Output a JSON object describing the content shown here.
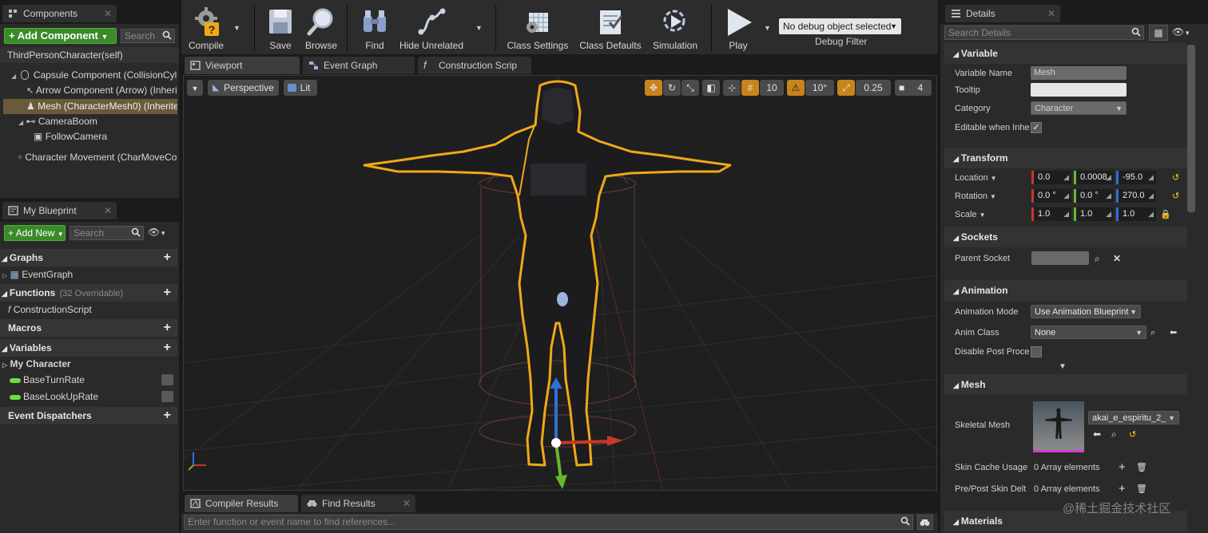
{
  "components": {
    "tab_label": "Components",
    "add_component_label": "+ Add Component",
    "search_placeholder": "Search",
    "self_label": "ThirdPersonCharacter(self)",
    "tree": [
      {
        "label": "Capsule Component (CollisionCylin"
      },
      {
        "label": "Arrow Component (Arrow) (Inheri"
      },
      {
        "label": "Mesh (CharacterMesh0) (Inherite"
      },
      {
        "label": "CameraBoom"
      },
      {
        "label": "FollowCamera"
      },
      {
        "label": "Character Movement (CharMoveCo"
      }
    ]
  },
  "my_blueprint": {
    "tab_label": "My Blueprint",
    "add_new_label": "+ Add New",
    "search_placeholder": "Search",
    "sections": {
      "graphs": "Graphs",
      "event_graph": "EventGraph",
      "functions": "Functions",
      "functions_count": "(32 Overridable)",
      "construction_script": "ConstructionScript",
      "macros": "Macros",
      "variables": "Variables",
      "my_character": "My Character",
      "var1": "BaseTurnRate",
      "var2": "BaseLookUpRate",
      "event_dispatchers": "Event Dispatchers"
    }
  },
  "toolbar": {
    "compile": "Compile",
    "save": "Save",
    "browse": "Browse",
    "find": "Find",
    "hide_unrelated": "Hide Unrelated",
    "class_settings": "Class Settings",
    "class_defaults": "Class Defaults",
    "simulation": "Simulation",
    "play": "Play",
    "debug_object": "No debug object selected",
    "debug_filter": "Debug Filter"
  },
  "editor_tabs": {
    "viewport": "Viewport",
    "event_graph": "Event Graph",
    "construction_script": "Construction Scrip"
  },
  "viewport": {
    "perspective": "Perspective",
    "lit": "Lit",
    "grid_snap": "10",
    "rot_snap": "10°",
    "scale_snap": "0.25",
    "cam_speed": "4"
  },
  "bottom": {
    "compiler_results": "Compiler Results",
    "find_results": "Find Results",
    "find_placeholder": "Enter function or event name to find references..."
  },
  "details": {
    "tab_label": "Details",
    "search_placeholder": "Search Details",
    "variable": {
      "header": "Variable",
      "name_label": "Variable Name",
      "name_value": "Mesh",
      "tooltip_label": "Tooltip",
      "category_label": "Category",
      "category_value": "Character",
      "editable_label": "Editable when Inhe"
    },
    "transform": {
      "header": "Transform",
      "location_label": "Location",
      "loc": [
        "0.0",
        "0.0008",
        "-95.0"
      ],
      "rotation_label": "Rotation",
      "rot": [
        "0.0 °",
        "0.0 °",
        "270.0"
      ],
      "scale_label": "Scale",
      "scale": [
        "1.0",
        "1.0",
        "1.0"
      ]
    },
    "sockets": {
      "header": "Sockets",
      "parent_socket_label": "Parent Socket"
    },
    "animation": {
      "header": "Animation",
      "mode_label": "Animation Mode",
      "mode_value": "Use Animation Blueprint",
      "anim_class_label": "Anim Class",
      "anim_class_value": "None",
      "disable_post_label": "Disable Post Proce"
    },
    "mesh": {
      "header": "Mesh",
      "skeletal_mesh_label": "Skeletal Mesh",
      "skeletal_mesh_value": "akai_e_espiritu_2_",
      "skin_cache_label": "Skin Cache Usage",
      "skin_cache_value": "0 Array elements",
      "pre_post_label": "Pre/Post Skin Delt",
      "pre_post_value": "0 Array elements"
    },
    "materials": {
      "header": "Materials"
    }
  },
  "watermark": "@稀土掘金技术社区",
  "colors": {
    "accent_green": "#3b8a2a",
    "selection": "#6b5a3a",
    "x_axis": "#c6382a",
    "y_axis": "#66b82e",
    "z_axis": "#2f6fd6",
    "outline": "#f0a818"
  }
}
